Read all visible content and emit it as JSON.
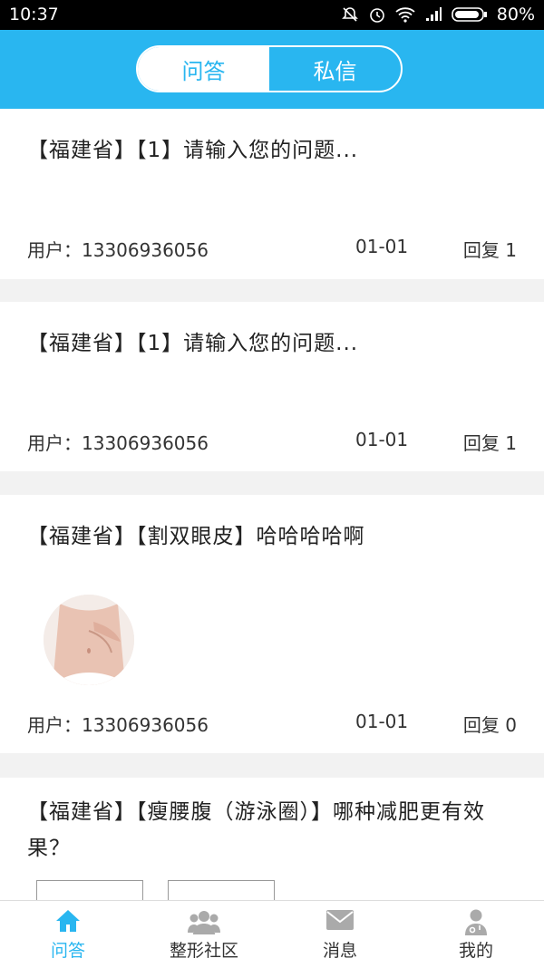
{
  "status_bar": {
    "time": "10:37",
    "battery": "80%"
  },
  "segment": {
    "qa_label": "问答",
    "messages_label": "私信"
  },
  "posts": [
    {
      "title": "【福建省】【1】请输入您的问题...",
      "user": "用户：13306936056",
      "date": "01-01",
      "reply": "回复 1"
    },
    {
      "title": "【福建省】【1】请输入您的问题...",
      "user": "用户：13306936056",
      "date": "01-01",
      "reply": "回复 1"
    },
    {
      "title": "【福建省】【割双眼皮】哈哈哈哈啊",
      "user": "用户：13306936056",
      "date": "01-01",
      "reply": "回复 0"
    },
    {
      "title": "【福建省】【瘦腰腹（游泳圈）】哪种减肥更有效果？"
    }
  ],
  "tabbar": {
    "qa": "问答",
    "community": "整形社区",
    "messages": "消息",
    "mine": "我的"
  },
  "colors": {
    "accent": "#29b6f0"
  }
}
